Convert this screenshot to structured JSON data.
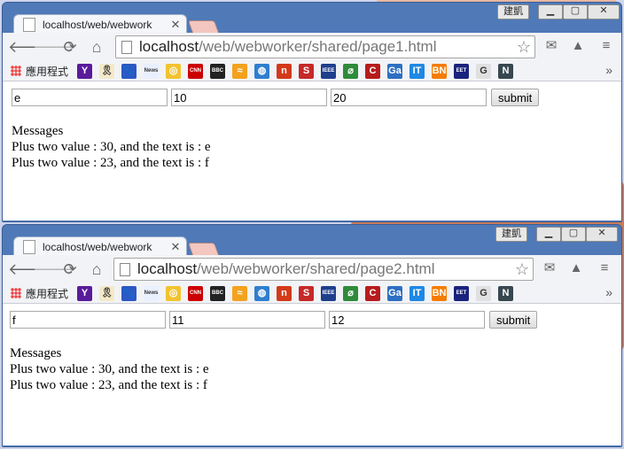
{
  "windows": [
    {
      "tab_title": "localhost/web/webwork",
      "url_host": "localhost",
      "url_path": "/web/webworker/shared/page1.html",
      "user_button": "建凱",
      "apps_label": "應用程式",
      "inputs": [
        "e",
        "10",
        "20"
      ],
      "submit_label": "submit",
      "messages_title": "Messages",
      "messages": [
        "Plus two value : 30, and the text is : e",
        "Plus two value : 23, and the text is : f"
      ]
    },
    {
      "tab_title": "localhost/web/webwork",
      "url_host": "localhost",
      "url_path": "/web/webworker/shared/page2.html",
      "user_button": "建凱",
      "apps_label": "應用程式",
      "inputs": [
        "f",
        "11",
        "12"
      ],
      "submit_label": "submit",
      "messages_title": "Messages",
      "messages": [
        "Plus two value : 30, and the text is : e",
        "Plus two value : 23, and the text is : f"
      ]
    }
  ],
  "bookmarks": [
    {
      "icon": "yahoo-icon",
      "text": "Y",
      "color": "#5a1b9b"
    },
    {
      "icon": "ribbon-icon",
      "text": "🎗",
      "color": "#f3e9c9"
    },
    {
      "icon": "baidu-paw-icon",
      "text": "🐾",
      "color": "#2b58c5"
    },
    {
      "icon": "news-icon",
      "text": "News",
      "color": "#e9f0ff"
    },
    {
      "icon": "chrome-circle-icon",
      "text": "◎",
      "color": "#f2c230"
    },
    {
      "icon": "cnn-icon",
      "text": "CNN",
      "color": "#cc0000"
    },
    {
      "icon": "bbc-icon",
      "text": "BBC",
      "color": "#222222"
    },
    {
      "icon": "flag-icon",
      "text": "≈",
      "color": "#f3a21f"
    },
    {
      "icon": "globe-icon",
      "text": "◍",
      "color": "#2f7fcf"
    },
    {
      "icon": "n-circle-icon",
      "text": "n",
      "color": "#d23a1a"
    },
    {
      "icon": "s-icon",
      "text": "S",
      "color": "#c62828"
    },
    {
      "icon": "ieee-icon",
      "text": "IEEE",
      "color": "#1f3f8c"
    },
    {
      "icon": "leaf-icon",
      "text": "⌀",
      "color": "#2e8b3a"
    },
    {
      "icon": "c-circle-icon",
      "text": "C",
      "color": "#b71c1c"
    },
    {
      "icon": "ga-icon",
      "text": "Ga",
      "color": "#2d6fc2"
    },
    {
      "icon": "it-icon",
      "text": "IT",
      "color": "#1e88e5"
    },
    {
      "icon": "bn-icon",
      "text": "BN",
      "color": "#f57c00"
    },
    {
      "icon": "eet-icon",
      "text": "EET",
      "color": "#1a237e"
    },
    {
      "icon": "translate-icon",
      "text": "G",
      "color": "#e0e0e0"
    },
    {
      "icon": "n-italic-icon",
      "text": "N",
      "color": "#37474f"
    }
  ],
  "colors": {
    "frame": "#4f79b7",
    "toolbar": "#f2f3f6",
    "page_bg": "#ffffff"
  }
}
